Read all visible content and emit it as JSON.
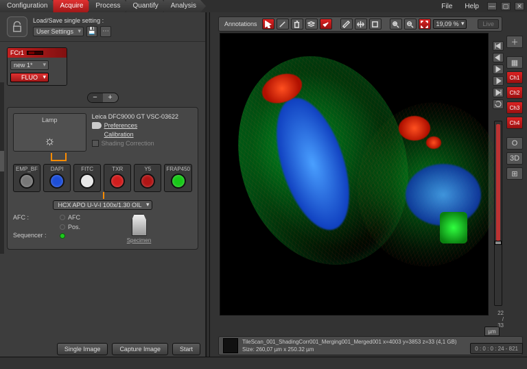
{
  "tabs": {
    "items": [
      "Configuration",
      "Acquire",
      "Process",
      "Quantify",
      "Analysis"
    ],
    "active": 1
  },
  "menus": {
    "file": "File",
    "help": "Help"
  },
  "load": {
    "title": "Load/Save single setting :",
    "select": "User Settings"
  },
  "fcr": {
    "name": "FCr1",
    "preset": "new 1*",
    "mode": "FLUO"
  },
  "lamp": {
    "label": "Lamp"
  },
  "camera": {
    "model": "Leica DFC9000 GT VSC-03622",
    "pref": "Preferences",
    "cal": "Calibration",
    "shading": "Shading Correction"
  },
  "filters": [
    {
      "label": "EMP_BF",
      "color": "#777"
    },
    {
      "label": "DAPI",
      "color": "#1e4fd8"
    },
    {
      "label": "FITC",
      "color": "#e8e8e8"
    },
    {
      "label": "TXR",
      "color": "#d01e1e"
    },
    {
      "label": "Y5",
      "color": "#b01515"
    },
    {
      "label": "FRAP450",
      "color": "#18c818"
    }
  ],
  "objective": "HCX APO U-V-I   100x/1.30 OIL",
  "afc": {
    "title": "AFC :",
    "r1": "AFC",
    "r2": "Pos."
  },
  "sequencer": {
    "title": "Sequencer :"
  },
  "specimen": "Specimen",
  "leftButtons": {
    "single": "Single Image",
    "capture": "Capture Image",
    "start": "Start"
  },
  "rtool": {
    "annot": "Annotations",
    "zoom": "19,09 %",
    "live": "Live"
  },
  "rightstack": {
    "ch": [
      "Ch1",
      "Ch2",
      "Ch3",
      "Ch4"
    ],
    "o": "O",
    "three": "3D"
  },
  "slider": {
    "cur": "22",
    "tot": "33"
  },
  "meta": {
    "name": "TileScan_001_ShadingCorr001_Merging001_Merged001 x=4003 y=3853 z=33  (4,1 GB)",
    "size": "Size: 260,07 µm x 250.32 µm"
  },
  "coords": "0 : 0 : 0 : 24 ‑ 821",
  "um": "µm"
}
